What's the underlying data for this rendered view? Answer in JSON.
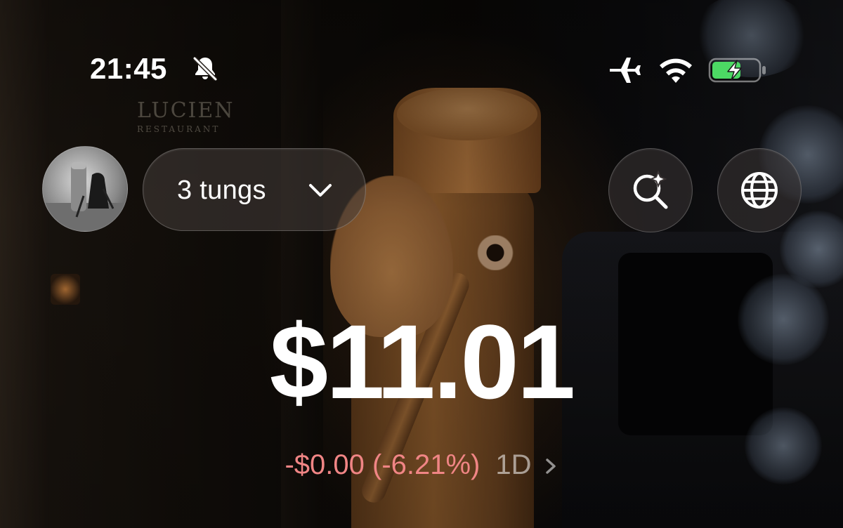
{
  "status_bar": {
    "time": "21:45",
    "icons": [
      "bell-muted-icon",
      "airplane-icon",
      "wifi-icon",
      "battery-charging-icon"
    ],
    "battery_color": "#4cd964"
  },
  "header": {
    "account_label": "3 tungs",
    "actions": [
      "search-sparkle-icon",
      "globe-icon"
    ]
  },
  "portfolio": {
    "balance": "$11.01",
    "change": "-$0.00 (-6.21%)",
    "period": "1D",
    "change_color": "#f08585"
  }
}
